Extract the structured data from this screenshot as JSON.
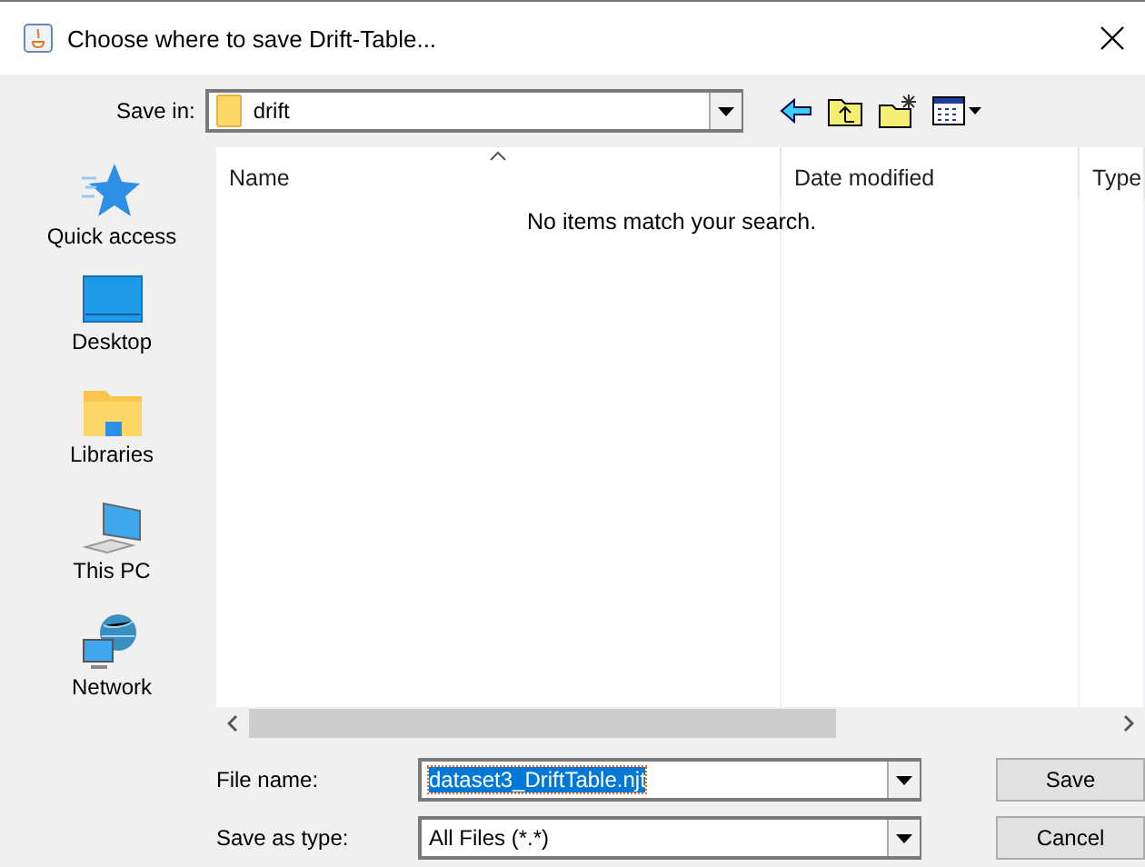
{
  "window": {
    "title": "Choose where to save Drift-Table..."
  },
  "save_in": {
    "label": "Save in:",
    "value": "drift"
  },
  "places": [
    {
      "kind": "star",
      "label": "Quick access"
    },
    {
      "kind": "desktop",
      "label": "Desktop"
    },
    {
      "kind": "libraries",
      "label": "Libraries"
    },
    {
      "kind": "pc",
      "label": "This PC"
    },
    {
      "kind": "network",
      "label": "Network"
    }
  ],
  "columns": [
    {
      "label": "Name",
      "sorted": true
    },
    {
      "label": "Date modified",
      "sorted": false
    },
    {
      "label": "Type",
      "sorted": false
    }
  ],
  "empty_message": "No items match your search.",
  "file_name": {
    "label": "File name:",
    "value": "dataset3_DriftTable.njt"
  },
  "save_as_type": {
    "label": "Save as type:",
    "value": "All Files (*.*)"
  },
  "buttons": [
    "Save",
    "Cancel"
  ]
}
